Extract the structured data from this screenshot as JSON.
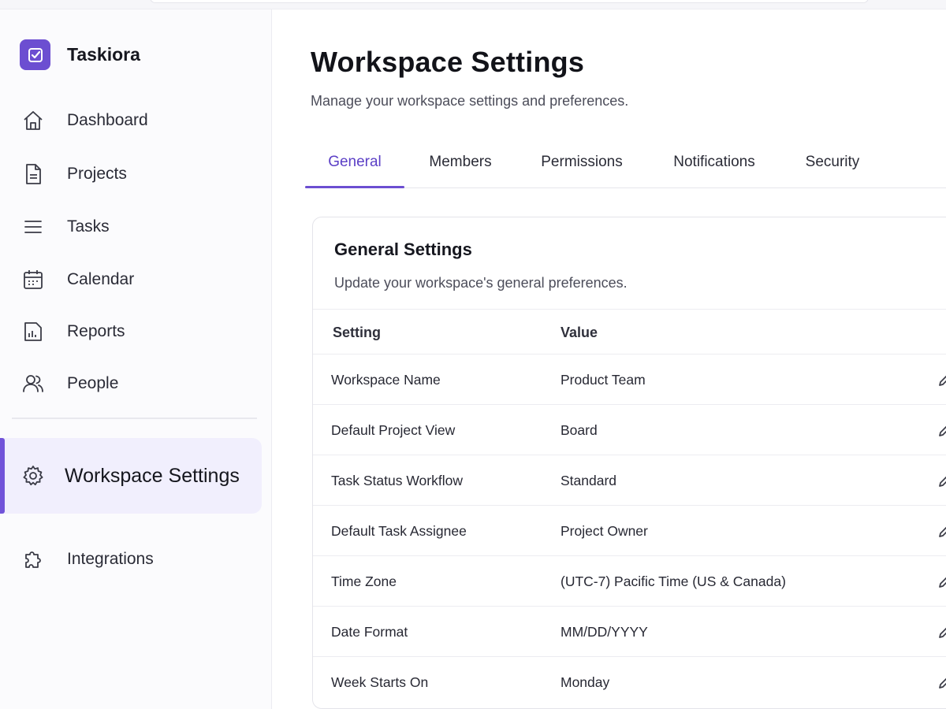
{
  "brand": {
    "name": "Taskiora",
    "logo_color": "#6c4ed1"
  },
  "sidebar": {
    "items": [
      {
        "label": "Dashboard",
        "icon": "home-icon"
      },
      {
        "label": "Projects",
        "icon": "document-icon"
      },
      {
        "label": "Tasks",
        "icon": "list-icon"
      },
      {
        "label": "Calendar",
        "icon": "calendar-icon"
      },
      {
        "label": "Reports",
        "icon": "chart-icon"
      },
      {
        "label": "People",
        "icon": "people-icon"
      }
    ],
    "active": {
      "label": "Workspace Settings",
      "icon": "gear-icon"
    },
    "extra": {
      "label": "Integrations",
      "icon": "puzzle-icon"
    }
  },
  "page": {
    "title": "Workspace Settings",
    "subtitle": "Manage your workspace settings and preferences."
  },
  "tabs": [
    {
      "label": "General",
      "active": true
    },
    {
      "label": "Members",
      "active": false
    },
    {
      "label": "Permissions",
      "active": false
    },
    {
      "label": "Notifications",
      "active": false
    },
    {
      "label": "Security",
      "active": false
    }
  ],
  "card": {
    "title": "General Settings",
    "subtitle": "Update your workspace's general preferences.",
    "columns": [
      "Setting",
      "Value"
    ],
    "rows": [
      {
        "setting": "Workspace Name",
        "value": "Product Team"
      },
      {
        "setting": "Default Project View",
        "value": "Board"
      },
      {
        "setting": "Task Status Workflow",
        "value": "Standard"
      },
      {
        "setting": "Default Task Assignee",
        "value": "Project Owner"
      },
      {
        "setting": "Time Zone",
        "value": "(UTC-7) Pacific Time (US & Canada)"
      },
      {
        "setting": "Date Format",
        "value": "MM/DD/YYYY"
      },
      {
        "setting": "Week Starts On",
        "value": "Monday"
      }
    ]
  },
  "colors": {
    "accent": "#6c4ed1",
    "active_bg": "#f1effd"
  }
}
